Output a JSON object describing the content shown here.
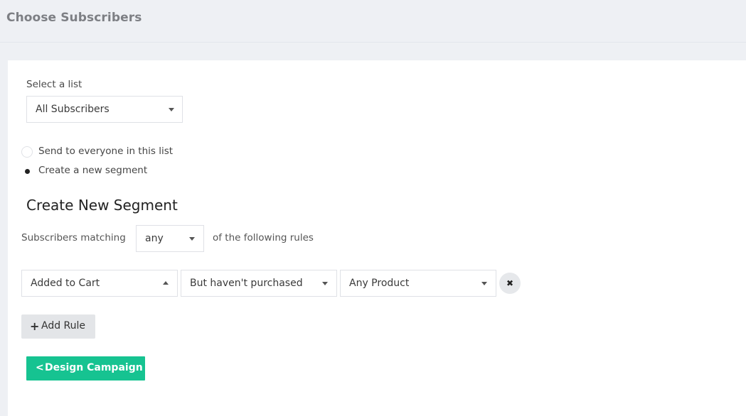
{
  "header": {
    "title": "Choose Subscribers"
  },
  "list_select": {
    "label": "Select a list",
    "value": "All Subscribers"
  },
  "send_options": [
    {
      "label": "Send to everyone in this list",
      "checked": false
    },
    {
      "label": "Create a new segment",
      "checked": true
    }
  ],
  "segment": {
    "title": "Create New Segment",
    "matching_prefix": "Subscribers matching",
    "matching_value": "any",
    "matching_suffix": "of the following rules",
    "rule": {
      "event": "Added to Cart",
      "condition": "But haven't purchased",
      "product": "Any Product",
      "remove_icon": "✖"
    },
    "add_rule_icon": "+",
    "add_rule_label": "Add Rule"
  },
  "actions": {
    "design_chevron": "<",
    "design_label": "Design Campaign"
  },
  "colors": {
    "accent": "#16c391",
    "background": "#eef0f4"
  }
}
